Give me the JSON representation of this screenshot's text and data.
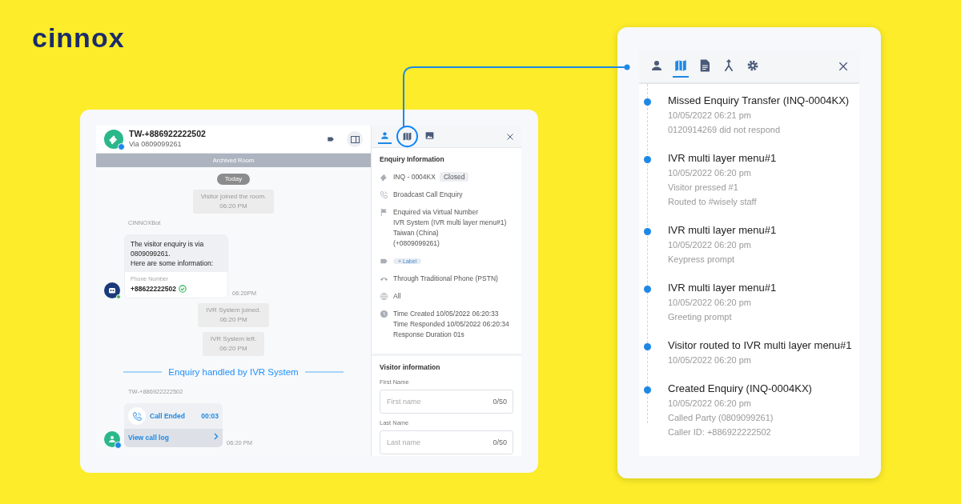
{
  "logo": {
    "text": "cinnox"
  },
  "chat": {
    "title": "TW-+886922222502",
    "subtitle": "Via 0809099261",
    "banner": "Archived Room",
    "date": "Today",
    "messages": [
      {
        "kind": "system",
        "lines": [
          "Visitor joined the room.",
          "06:20 PM"
        ]
      },
      {
        "kind": "bot",
        "sender": "CINNOXBot",
        "lines": [
          "The visitor enquiry is via 0809099261.",
          "Here are some information:"
        ],
        "field_label": "Phone Number",
        "field_value": "+88622222502",
        "verified": true,
        "time": "06:20PM"
      },
      {
        "kind": "system",
        "lines": [
          "IVR System joined.",
          "06:20 PM"
        ]
      },
      {
        "kind": "system",
        "lines": [
          "IVR System left.",
          "06:20 PM"
        ]
      },
      {
        "kind": "divider",
        "text": "Enquiry handled by IVR System"
      },
      {
        "kind": "call",
        "sender": "TW-+886922222502",
        "status": "Call Ended",
        "duration": "00:03",
        "link": "View call log",
        "time": "06:20 PM"
      }
    ]
  },
  "details": {
    "tabs": [
      {
        "kind": "person",
        "selected": true,
        "callout": false
      },
      {
        "kind": "map",
        "selected": false,
        "callout": true
      },
      {
        "kind": "image",
        "selected": false,
        "callout": false
      }
    ],
    "enquiry": {
      "title": "Enquiry Information",
      "rows": [
        {
          "kind": "ticket",
          "lines": [
            "INQ - 0004KX"
          ],
          "badge": "Closed"
        },
        {
          "kind": "call",
          "lines": [
            "Broadcast Call Enquiry"
          ]
        },
        {
          "kind": "flag",
          "lines": [
            "Enquired via Virtual Number",
            "IVR System (IVR multi layer menu#1)",
            "Taiwan (China)",
            "(+0809099261)"
          ]
        },
        {
          "kind": "tag",
          "chip": "+ Label"
        },
        {
          "kind": "phone",
          "lines": [
            "Through Traditional Phone (PSTN)"
          ]
        },
        {
          "kind": "globe",
          "lines": [
            "All"
          ]
        },
        {
          "kind": "clock",
          "lines": [
            "Time Created 10/05/2022 06:20:33",
            "Time Responded 10/05/2022 06:20:34",
            "Response Duration 01s"
          ]
        }
      ]
    },
    "visitor": {
      "title": "Visitor information",
      "fields": [
        {
          "label": "First Name",
          "placeholder": "First name",
          "counter": "0/50"
        },
        {
          "label": "Last Name",
          "placeholder": "Last name",
          "counter": "0/50"
        }
      ]
    }
  },
  "journey": {
    "tabs": [
      {
        "kind": "person",
        "selected": false
      },
      {
        "kind": "map",
        "selected": true
      },
      {
        "kind": "document",
        "selected": false
      },
      {
        "kind": "merge",
        "selected": false
      },
      {
        "kind": "gear",
        "selected": false
      }
    ],
    "events": [
      {
        "title": "Missed Enquiry Transfer (INQ-0004KX)",
        "time": "10/05/2022 06:21 pm",
        "notes": [
          "0120914269 did not respond"
        ]
      },
      {
        "title": "IVR multi layer menu#1",
        "time": "10/05/2022 06:20 pm",
        "notes": [
          "Visitor pressed #1",
          "Routed to #wisely staff"
        ]
      },
      {
        "title": "IVR multi layer menu#1",
        "time": "10/05/2022 06:20 pm",
        "notes": [
          "Keypress prompt"
        ]
      },
      {
        "title": "IVR multi layer menu#1",
        "time": "10/05/2022 06:20 pm",
        "notes": [
          "Greeting prompt"
        ]
      },
      {
        "title": "Visitor routed to IVR multi layer menu#1",
        "time": "10/05/2022 06:20 pm"
      },
      {
        "title": "Created Enquiry (INQ-0004KX)",
        "time": "10/05/2022 06:20 pm",
        "notes": [
          "Called Party (0809099261)",
          "Caller ID: +886922222502"
        ]
      }
    ]
  }
}
